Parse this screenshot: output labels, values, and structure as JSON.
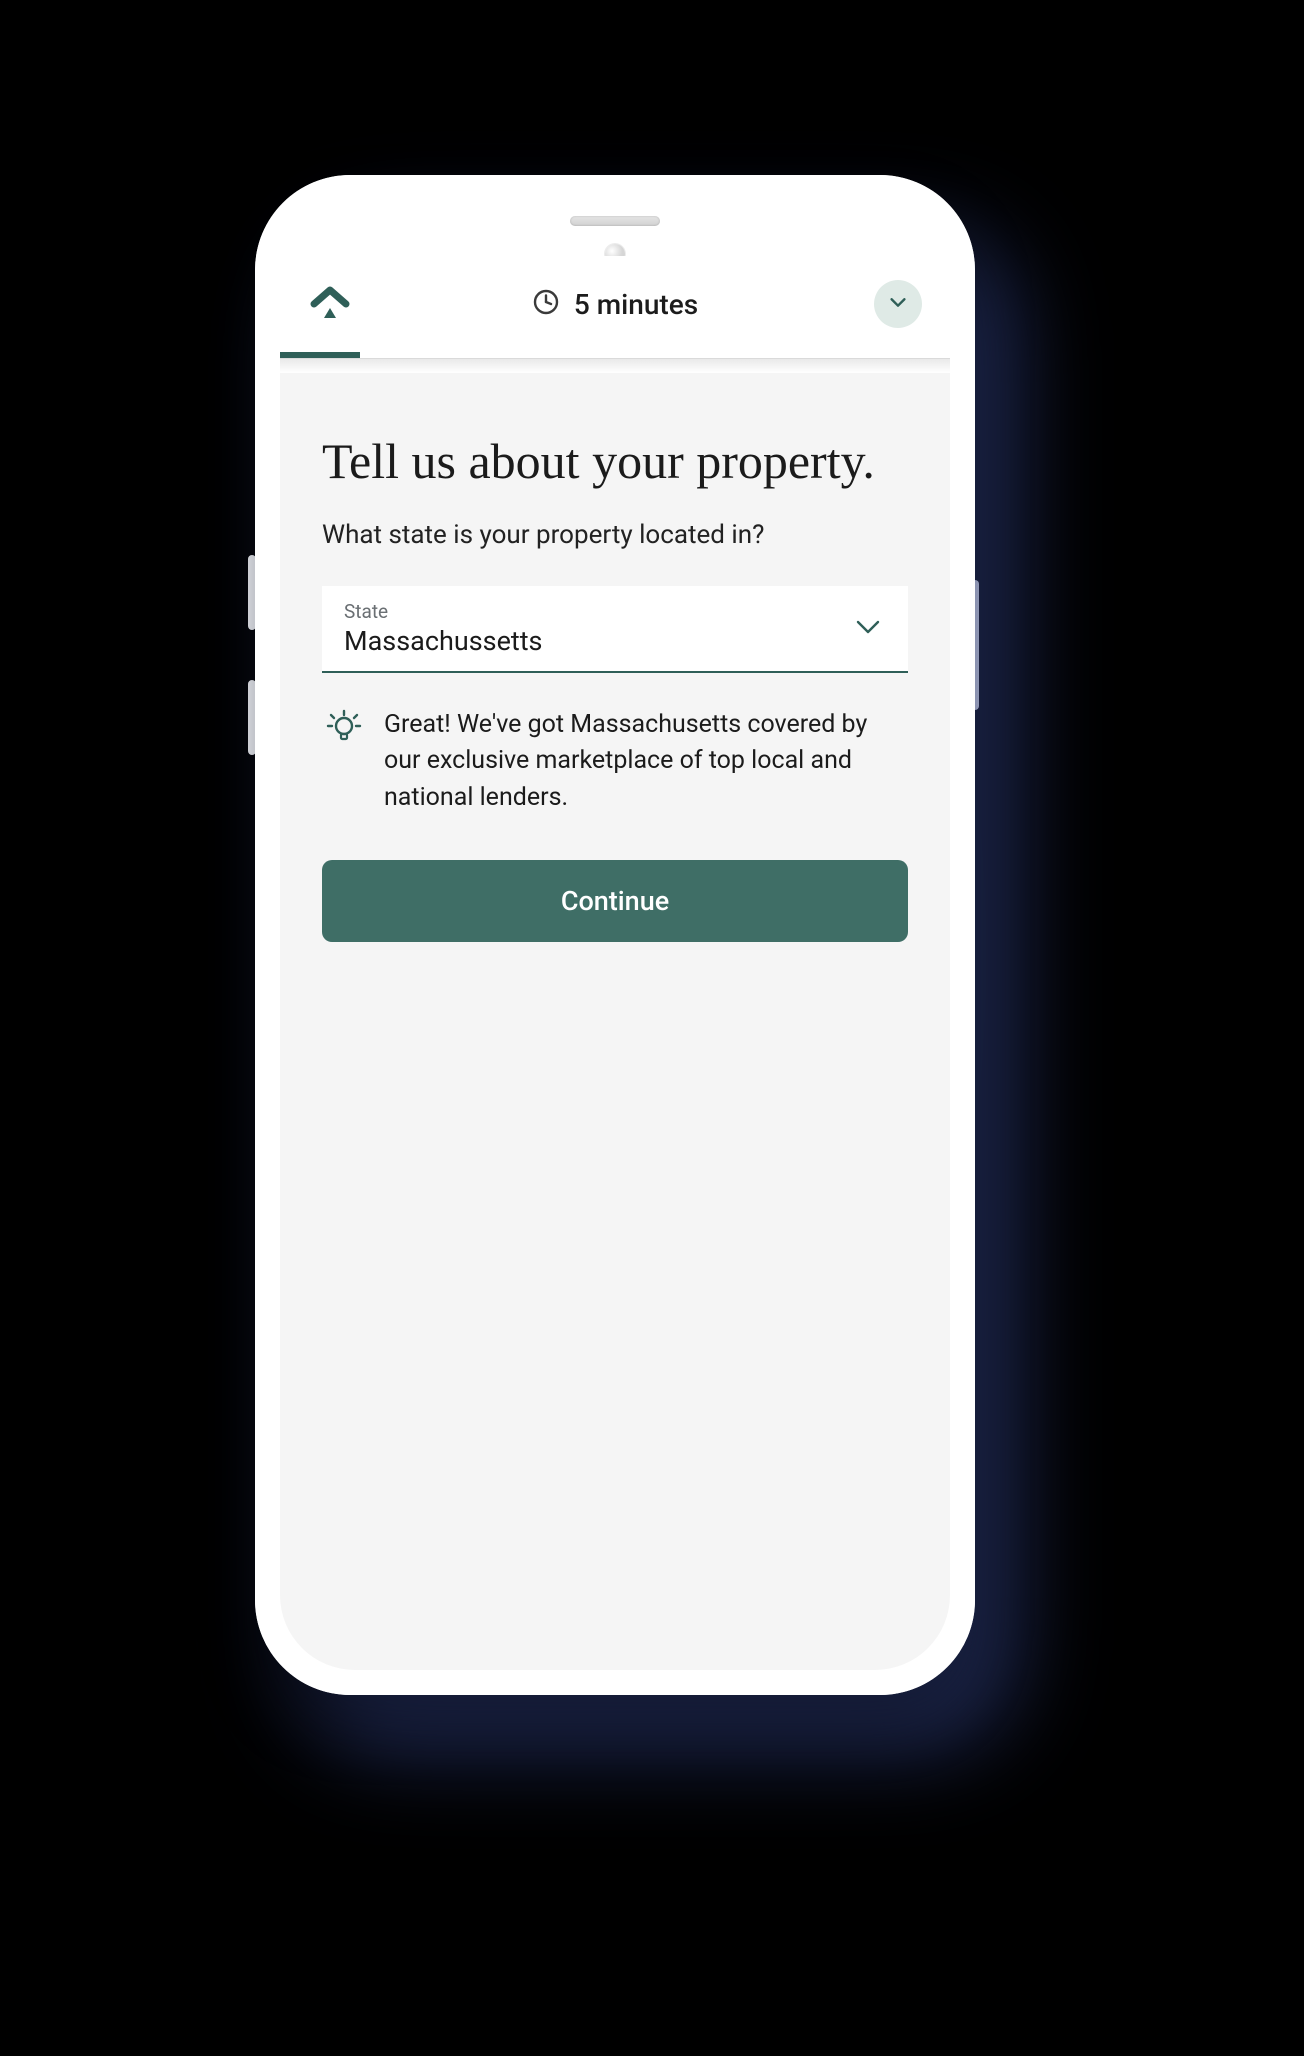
{
  "header": {
    "time_label": "5 minutes"
  },
  "page": {
    "title": "Tell us about your property.",
    "question": "What state is your property located in?"
  },
  "state_select": {
    "label": "State",
    "value": "Massachussetts"
  },
  "tip": {
    "text": "Great! We've got Massachusetts covered by our exclusive marketplace of top local and national lenders."
  },
  "cta": {
    "label": "Continue"
  },
  "progress": {
    "percent": 12
  },
  "colors": {
    "brand": "#3f6e66",
    "brand_dark": "#2f5f58"
  }
}
